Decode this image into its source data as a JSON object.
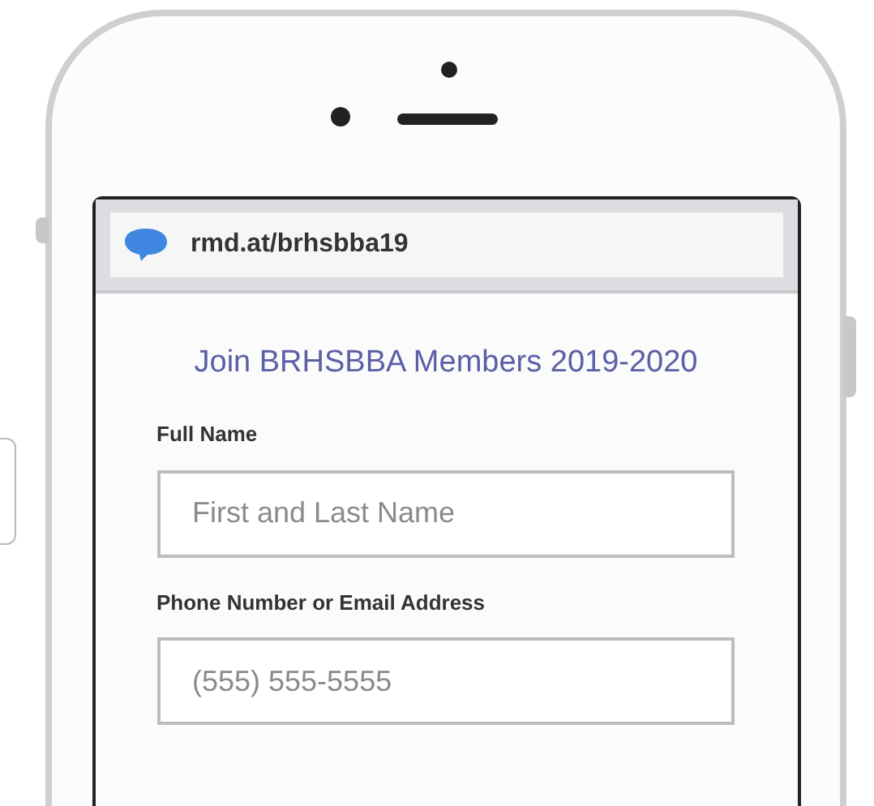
{
  "address_bar": {
    "url": "rmd.at/brhsbba19"
  },
  "form": {
    "title": "Join BRHSBBA Members 2019-2020",
    "fields": [
      {
        "label": "Full Name",
        "placeholder": "First and Last Name"
      },
      {
        "label": "Phone Number or Email Address",
        "placeholder": "(555) 555-5555"
      }
    ]
  }
}
